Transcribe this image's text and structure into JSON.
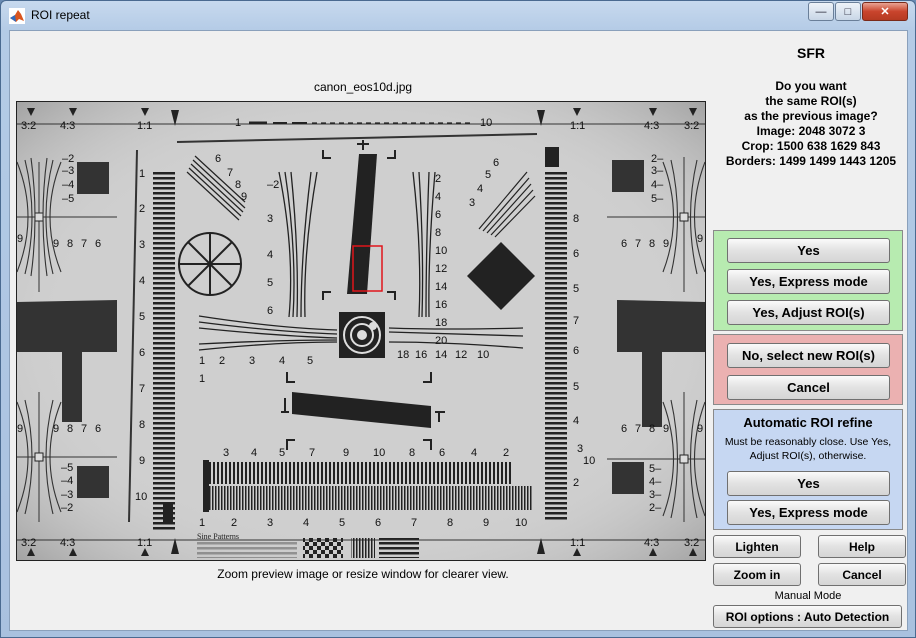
{
  "window": {
    "title": "ROI repeat",
    "min": "—",
    "max": "□",
    "close": "✕"
  },
  "image": {
    "filename": "canon_eos10d.jpg",
    "hint": "Zoom preview image or resize window for clearer view.",
    "chart_labels": {
      "corner_tl_a": "3:2",
      "corner_tl_b": "4:3",
      "corner_tl_c": "1:1",
      "corner_tr_a": "1:1",
      "corner_tr_b": "4:3",
      "corner_tr_c": "3:2",
      "corner_bl_a": "3:2",
      "corner_bl_b": "4:3",
      "corner_bl_c": "1:1",
      "corner_br_a": "1:1",
      "corner_br_b": "4:3",
      "corner_br_c": "3:2",
      "scale_left": "1",
      "scale_right": "10",
      "sine_patterns": "Sine Patterns"
    },
    "bottom_scale": [
      "1",
      "2",
      "3",
      "4",
      "5",
      "6",
      "7",
      "8",
      "9",
      "10"
    ],
    "top_freq": [
      "3",
      "4",
      "5",
      "6",
      "7",
      "8",
      "9",
      "10",
      "8",
      "6",
      "4",
      "2"
    ],
    "center_row": [
      "18",
      "16",
      "14",
      "12",
      "10"
    ],
    "left_row": [
      "1",
      "2",
      "3",
      "4",
      "5"
    ],
    "left_col": [
      "2",
      "3",
      "4",
      "5",
      "6"
    ],
    "right_col": [
      "2",
      "4",
      "6",
      "8",
      "10",
      "12",
      "14",
      "16",
      "18",
      "20"
    ],
    "ladder_nums": [
      "1",
      "2",
      "3",
      "4",
      "5",
      "6",
      "7",
      "8",
      "9",
      "10"
    ],
    "right_ladder": [
      "8",
      "7",
      "6",
      "5",
      "4",
      "3",
      "2"
    ]
  },
  "sfr": {
    "title": "SFR",
    "q1": "Do you want",
    "q2": "the same ROI(s)",
    "q3": "as the previous image?",
    "image_line": "Image:  2048  3072    3",
    "crop_line": "Crop:  1500   638  1629   843",
    "borders_line": "Borders:  1499  1499  1443  1205"
  },
  "green": {
    "yes": "Yes",
    "express": "Yes, Express mode",
    "adjust": "Yes, Adjust ROI(s)",
    "bg": "#b7ebb0"
  },
  "red": {
    "no": "No, select new ROI(s)",
    "cancel": "Cancel",
    "bg": "#ebb1b1"
  },
  "blue": {
    "title": "Automatic ROI refine",
    "note": "Must be reasonably close.  Use Yes, Adjust ROI(s), otherwise.",
    "yes": "Yes",
    "express": "Yes, Express mode",
    "bg": "#c6d7f2"
  },
  "footer": {
    "lighten": "Lighten",
    "help": "Help",
    "zoom": "Zoom in",
    "cancel": "Cancel",
    "mode": "Manual Mode",
    "roi_options": "ROI options : Auto Detection"
  }
}
